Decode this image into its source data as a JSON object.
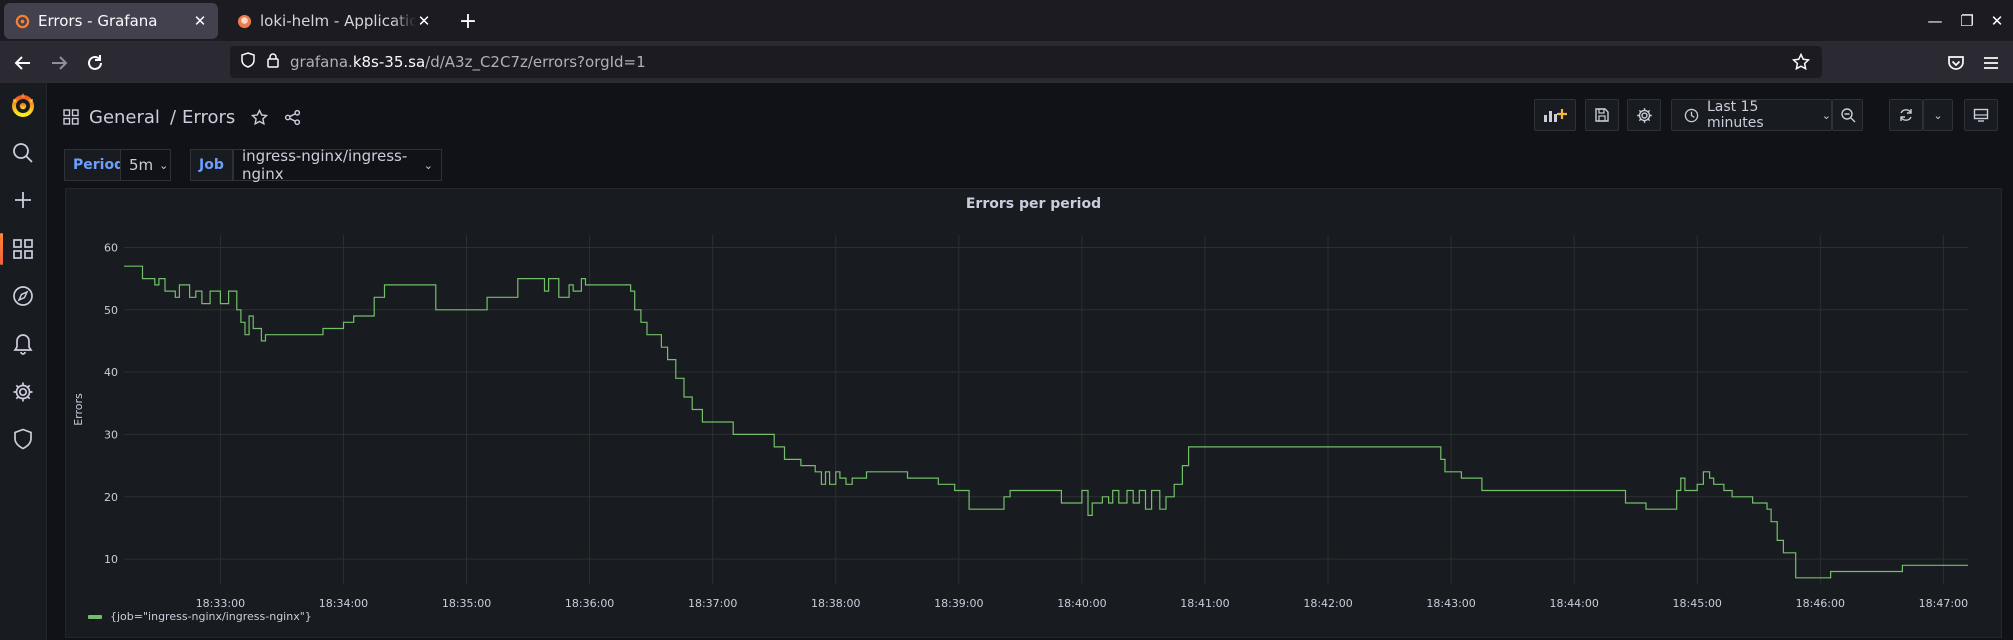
{
  "browser": {
    "tabs": [
      {
        "title": "Errors - Grafana",
        "active": true
      },
      {
        "title": "loki-helm - Application Details",
        "active": false
      }
    ],
    "url_prefix": "grafana.",
    "url_host": "k8s-35.sa",
    "url_path": "/d/A3z_C2C7z/errors?orgId=1"
  },
  "dashboard": {
    "breadcrumb_folder": "General",
    "breadcrumb_sep": "/",
    "title": "Errors",
    "time_range": "Last 15 minutes"
  },
  "variables": [
    {
      "label": "Period",
      "value": "5m"
    },
    {
      "label": "Job",
      "value": "ingress-nginx/ingress-nginx"
    }
  ],
  "sidebar": {
    "icons": [
      "grafana-logo-icon",
      "search-icon",
      "plus-icon",
      "dashboards-icon",
      "explore-compass-icon",
      "alerting-bell-icon",
      "configuration-gear-icon",
      "server-admin-shield-icon"
    ],
    "active": "dashboards-icon"
  },
  "colors": {
    "series": "#73bf69",
    "background": "#111217",
    "panel": "#181b1f",
    "accent": "#f55f3e",
    "variable_label": "#6e9fff"
  },
  "chart_data": {
    "type": "line",
    "title": "Errors per period",
    "ylabel": "Errors",
    "xlabel": "",
    "ylim": [
      6,
      62
    ],
    "y_ticks": [
      10,
      20,
      30,
      40,
      50,
      60
    ],
    "x_ticks": [
      "18:33:00",
      "18:34:00",
      "18:35:00",
      "18:36:00",
      "18:37:00",
      "18:38:00",
      "18:39:00",
      "18:40:00",
      "18:41:00",
      "18:42:00",
      "18:43:00",
      "18:44:00",
      "18:45:00",
      "18:46:00",
      "18:47:00"
    ],
    "xlim": [
      "18:32:13",
      "18:47:12"
    ],
    "grid": true,
    "legend_position": "bottom-left",
    "series": [
      {
        "name": "{job=\"ingress-nginx/ingress-nginx\"}",
        "color": "#73bf69",
        "step": true,
        "points": [
          [
            "18:32:13",
            57
          ],
          [
            "18:32:22",
            55
          ],
          [
            "18:32:28",
            54
          ],
          [
            "18:32:30",
            55
          ],
          [
            "18:32:33",
            53
          ],
          [
            "18:32:38",
            52
          ],
          [
            "18:32:40",
            54
          ],
          [
            "18:32:45",
            52
          ],
          [
            "18:32:48",
            53
          ],
          [
            "18:32:51",
            51
          ],
          [
            "18:32:55",
            53
          ],
          [
            "18:33:00",
            51
          ],
          [
            "18:33:04",
            53
          ],
          [
            "18:33:08",
            50
          ],
          [
            "18:33:10",
            48
          ],
          [
            "18:33:12",
            46
          ],
          [
            "18:33:14",
            49
          ],
          [
            "18:33:16",
            47
          ],
          [
            "18:33:20",
            45
          ],
          [
            "18:33:22",
            46
          ],
          [
            "18:33:50",
            47
          ],
          [
            "18:34:00",
            48
          ],
          [
            "18:34:05",
            49
          ],
          [
            "18:34:15",
            52
          ],
          [
            "18:34:20",
            54
          ],
          [
            "18:34:45",
            50
          ],
          [
            "18:35:10",
            52
          ],
          [
            "18:35:25",
            55
          ],
          [
            "18:35:38",
            53
          ],
          [
            "18:35:40",
            55
          ],
          [
            "18:35:45",
            52
          ],
          [
            "18:35:50",
            54
          ],
          [
            "18:35:52",
            53
          ],
          [
            "18:35:56",
            55
          ],
          [
            "18:35:58",
            54
          ],
          [
            "18:36:20",
            53
          ],
          [
            "18:36:22",
            50
          ],
          [
            "18:36:25",
            48
          ],
          [
            "18:36:28",
            46
          ],
          [
            "18:36:35",
            44
          ],
          [
            "18:36:38",
            42
          ],
          [
            "18:36:42",
            39
          ],
          [
            "18:36:46",
            36
          ],
          [
            "18:36:50",
            34
          ],
          [
            "18:36:55",
            32
          ],
          [
            "18:37:10",
            30
          ],
          [
            "18:37:30",
            28
          ],
          [
            "18:37:35",
            26
          ],
          [
            "18:37:43",
            25
          ],
          [
            "18:37:50",
            24
          ],
          [
            "18:37:53",
            22
          ],
          [
            "18:37:55",
            24
          ],
          [
            "18:37:57",
            22
          ],
          [
            "18:38:00",
            24
          ],
          [
            "18:38:02",
            23
          ],
          [
            "18:38:05",
            22
          ],
          [
            "18:38:08",
            23
          ],
          [
            "18:38:15",
            24
          ],
          [
            "18:38:35",
            23
          ],
          [
            "18:38:50",
            22
          ],
          [
            "18:38:58",
            21
          ],
          [
            "18:39:05",
            18
          ],
          [
            "18:39:22",
            20
          ],
          [
            "18:39:25",
            21
          ],
          [
            "18:39:50",
            19
          ],
          [
            "18:40:00",
            21
          ],
          [
            "18:40:03",
            17
          ],
          [
            "18:40:05",
            19
          ],
          [
            "18:40:10",
            20
          ],
          [
            "18:40:13",
            19
          ],
          [
            "18:40:15",
            21
          ],
          [
            "18:40:18",
            19
          ],
          [
            "18:40:22",
            21
          ],
          [
            "18:40:25",
            19
          ],
          [
            "18:40:28",
            21
          ],
          [
            "18:40:31",
            18
          ],
          [
            "18:40:34",
            21
          ],
          [
            "18:40:38",
            18
          ],
          [
            "18:40:41",
            20
          ],
          [
            "18:40:45",
            22
          ],
          [
            "18:40:49",
            25
          ],
          [
            "18:40:52",
            28
          ],
          [
            "18:42:55",
            26
          ],
          [
            "18:42:57",
            24
          ],
          [
            "18:43:05",
            23
          ],
          [
            "18:43:15",
            21
          ],
          [
            "18:44:25",
            19
          ],
          [
            "18:44:35",
            18
          ],
          [
            "18:44:50",
            21
          ],
          [
            "18:44:52",
            23
          ],
          [
            "18:44:54",
            21
          ],
          [
            "18:45:00",
            22
          ],
          [
            "18:45:03",
            24
          ],
          [
            "18:45:06",
            23
          ],
          [
            "18:45:08",
            22
          ],
          [
            "18:45:13",
            21
          ],
          [
            "18:45:17",
            20
          ],
          [
            "18:45:27",
            19
          ],
          [
            "18:45:34",
            18
          ],
          [
            "18:45:36",
            16
          ],
          [
            "18:45:39",
            13
          ],
          [
            "18:45:42",
            11
          ],
          [
            "18:45:48",
            7
          ],
          [
            "18:46:05",
            8
          ],
          [
            "18:46:40",
            9
          ],
          [
            "18:47:12",
            9
          ]
        ]
      }
    ]
  }
}
